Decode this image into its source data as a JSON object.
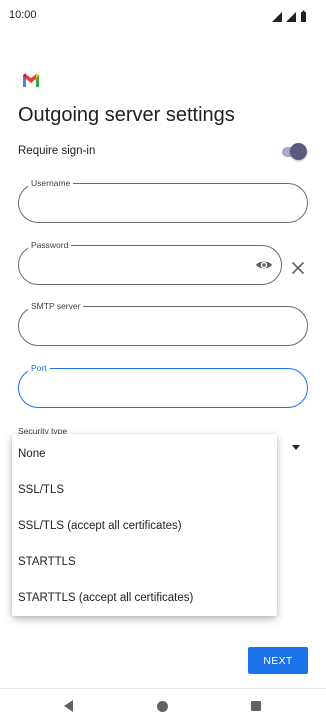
{
  "status_bar": {
    "time": "10:00",
    "icons": [
      "signal-icon",
      "signal-icon",
      "battery-icon"
    ]
  },
  "header": {
    "logo": "gmail-logo-icon",
    "title": "Outgoing server settings"
  },
  "require_sign_in": {
    "label": "Require sign-in",
    "enabled": true
  },
  "fields": {
    "username": {
      "label": "Username",
      "value": ""
    },
    "password": {
      "label": "Password",
      "value": ""
    },
    "smtp_server": {
      "label": "SMTP server",
      "value": ""
    },
    "port": {
      "label": "Port",
      "value": ""
    }
  },
  "security_type": {
    "label": "Security type",
    "options": [
      "None",
      "SSL/TLS",
      "SSL/TLS (accept all certificates)",
      "STARTTLS",
      "STARTTLS (accept all certificates)"
    ]
  },
  "actions": {
    "next_label": "NEXT"
  },
  "colors": {
    "accent": "#1a73e8",
    "toggle_thumb": "#5a5a7e",
    "toggle_track": "#a9a9c2"
  }
}
